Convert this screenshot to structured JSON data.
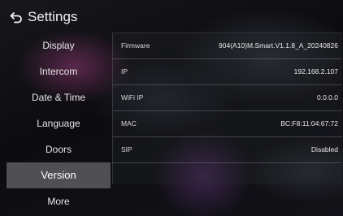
{
  "header": {
    "title": "Settings",
    "back_icon": "back-arrow-icon"
  },
  "sidebar": {
    "items": [
      {
        "label": "Display"
      },
      {
        "label": "Intercom"
      },
      {
        "label": "Date & Time"
      },
      {
        "label": "Language"
      },
      {
        "label": "Doors"
      },
      {
        "label": "Version",
        "selected": true
      },
      {
        "label": "More"
      }
    ]
  },
  "version_info": {
    "rows": [
      {
        "label": "Firmware",
        "value": "904(A10)M.Smart.V1.1.8_A_20240826"
      },
      {
        "label": "IP",
        "value": "192.168.2.107"
      },
      {
        "label": "WiFi IP",
        "value": "0.0.0.0"
      },
      {
        "label": "MAC",
        "value": "BC:F8:11:04:67:72"
      },
      {
        "label": "SIP",
        "value": "Disabled"
      }
    ]
  },
  "colors": {
    "selected_bg": "#56565a",
    "text": "#e6e6e6",
    "background": "#0c0c10"
  }
}
